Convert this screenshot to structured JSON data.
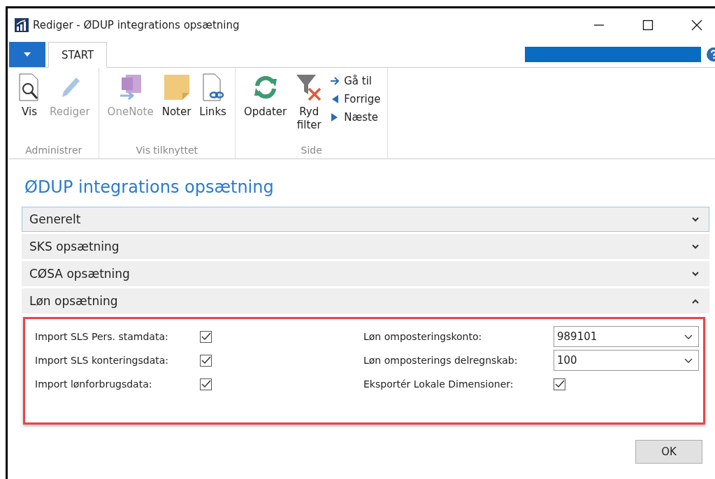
{
  "window": {
    "title": "Rediger - ØDUP integrations opsætning"
  },
  "tabs": [
    {
      "label": "START",
      "selected": true
    }
  ],
  "ribbon": {
    "groups": [
      {
        "label": "Administrer",
        "buttons": [
          {
            "label": "Vis",
            "disabled": false
          },
          {
            "label": "Rediger",
            "disabled": true
          }
        ]
      },
      {
        "label": "Vis tilknyttet",
        "buttons": [
          {
            "label": "OneNote",
            "disabled": true
          },
          {
            "label": "Noter",
            "disabled": false
          },
          {
            "label": "Links",
            "disabled": false
          }
        ]
      },
      {
        "label": "Side",
        "buttons": [
          {
            "label": "Opdater",
            "disabled": false
          },
          {
            "label": "Ryd\nfilter",
            "disabled": false
          }
        ],
        "small_buttons": [
          {
            "label": "Gå til"
          },
          {
            "label": "Forrige"
          },
          {
            "label": "Næste"
          }
        ]
      }
    ]
  },
  "page_title": "ØDUP integrations opsætning",
  "sections": [
    {
      "label": "Generelt",
      "expanded": false,
      "selected": true
    },
    {
      "label": "SKS opsætning",
      "expanded": false,
      "selected": false
    },
    {
      "label": "CØSA opsætning",
      "expanded": false,
      "selected": false
    },
    {
      "label": "Løn opsætning",
      "expanded": true,
      "selected": false
    }
  ],
  "fields_left": [
    {
      "kind": "checkbox",
      "label": "Import SLS Pers. stamdata:",
      "checked": true
    },
    {
      "kind": "checkbox",
      "label": "Import SLS konteringsdata:",
      "checked": true
    },
    {
      "kind": "checkbox",
      "label": "Import lønforbrugsdata:",
      "checked": true
    }
  ],
  "fields_right": [
    {
      "kind": "dropdown",
      "label": "Løn omposteringskonto:",
      "value": "989101"
    },
    {
      "kind": "dropdown",
      "label": "Løn omposterings delregnskab:",
      "value": "100"
    },
    {
      "kind": "checkbox",
      "label": "Eksportér Lokale Dimensioner:",
      "checked": true
    }
  ],
  "buttons": [
    "OK"
  ]
}
